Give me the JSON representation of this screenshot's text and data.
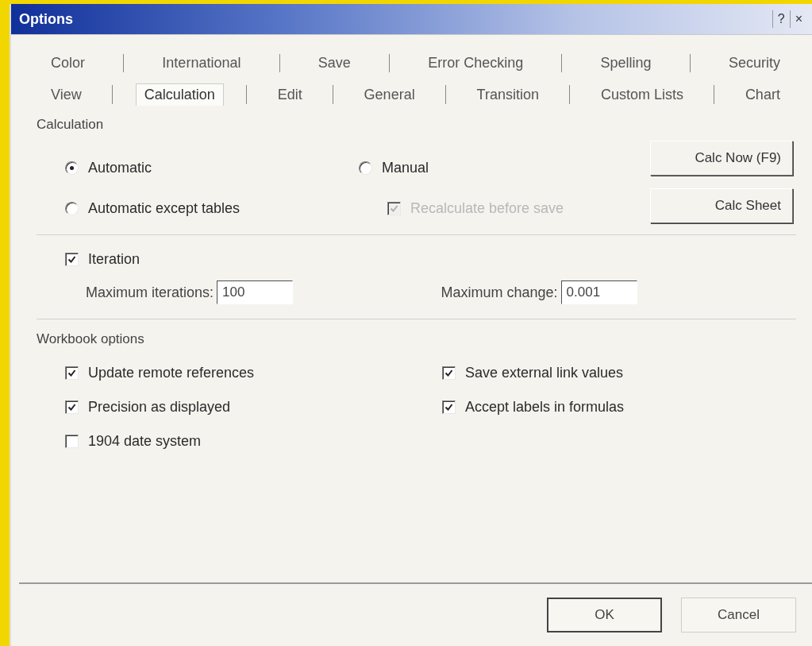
{
  "window": {
    "title": "Options",
    "help": "?",
    "close": "×"
  },
  "tab_rows": [
    {
      "tabs": [
        {
          "label": "Color",
          "selected": false
        },
        {
          "label": "International",
          "selected": false
        },
        {
          "label": "Save",
          "selected": false
        },
        {
          "label": "Error Checking",
          "selected": false
        },
        {
          "label": "Spelling",
          "selected": false
        },
        {
          "label": "Security",
          "selected": false
        }
      ]
    },
    {
      "tabs": [
        {
          "label": "View",
          "selected": false
        },
        {
          "label": "Calculation",
          "selected": true
        },
        {
          "label": "Edit",
          "selected": false
        },
        {
          "label": "General",
          "selected": false
        },
        {
          "label": "Transition",
          "selected": false
        },
        {
          "label": "Custom Lists",
          "selected": false
        },
        {
          "label": "Chart",
          "selected": false
        }
      ]
    }
  ],
  "calculation": {
    "heading": "Calculation",
    "modes": [
      {
        "label": "Automatic",
        "selected": true
      },
      {
        "label": "Automatic except tables",
        "selected": false
      },
      {
        "label": "Manual",
        "selected": false
      }
    ],
    "recalculate": {
      "label": "Recalculate before save",
      "checked": true,
      "disabled": true
    },
    "buttons": [
      "Calc Now (F9)",
      "Calc Sheet"
    ]
  },
  "iteration": {
    "label": "Iteration",
    "checked": true,
    "fields": [
      {
        "label": "Maximum iterations:",
        "value": "100"
      },
      {
        "label": "Maximum change:",
        "value": "0.001"
      }
    ]
  },
  "workbook_options": {
    "heading": "Workbook options",
    "items": [
      {
        "label": "Update remote references",
        "checked": true
      },
      {
        "label": "Save external link values",
        "checked": true
      },
      {
        "label": "Precision as displayed",
        "checked": true
      },
      {
        "label": "Accept labels in formulas",
        "checked": true
      },
      {
        "label": "1904 date system",
        "checked": false
      }
    ]
  },
  "buttons": [
    {
      "label": "OK",
      "default": true
    },
    {
      "label": "Cancel",
      "default": false
    }
  ]
}
